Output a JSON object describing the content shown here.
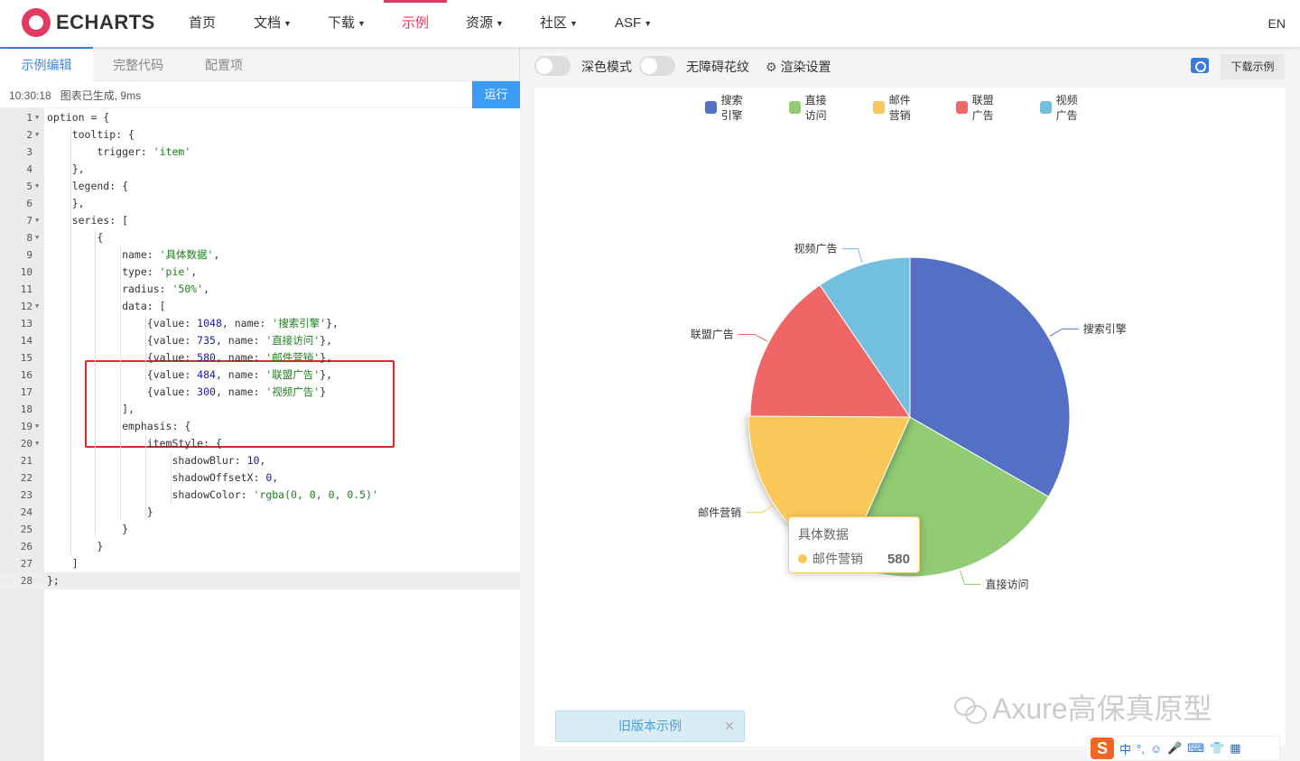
{
  "nav": {
    "logo": "ECHARTS",
    "items": [
      {
        "label": "首页",
        "dropdown": false
      },
      {
        "label": "文档",
        "dropdown": true
      },
      {
        "label": "下载",
        "dropdown": true
      },
      {
        "label": "示例",
        "dropdown": false,
        "active": true
      },
      {
        "label": "资源",
        "dropdown": true
      },
      {
        "label": "社区",
        "dropdown": true
      },
      {
        "label": "ASF",
        "dropdown": true
      }
    ],
    "lang": "EN"
  },
  "editor": {
    "tabs": [
      "示例编辑",
      "完整代码",
      "配置项"
    ],
    "status_time": "10:30:18",
    "status_msg": "图表已生成, 9ms",
    "run_label": "运行",
    "lines": [
      "option = {",
      "    tooltip: {",
      "        trigger: 'item'",
      "    },",
      "    legend: {",
      "    },",
      "    series: [",
      "        {",
      "            name: '具体数据',",
      "            type: 'pie',",
      "            radius: '50%',",
      "            data: [",
      "                {value: 1048, name: '搜索引擎'},",
      "                {value: 735, name: '直接访问'},",
      "                {value: 580, name: '邮件营销'},",
      "                {value: 484, name: '联盟广告'},",
      "                {value: 300, name: '视频广告'}",
      "            ],",
      "            emphasis: {",
      "                itemStyle: {",
      "                    shadowBlur: 10,",
      "                    shadowOffsetX: 0,",
      "                    shadowColor: 'rgba(0, 0, 0, 0.5)'",
      "                }",
      "            }",
      "        }",
      "    ]",
      "};"
    ]
  },
  "toolbar": {
    "dark_mode": "深色模式",
    "a11y": "无障碍花纹",
    "render_settings": "渲染设置",
    "download": "下载示例"
  },
  "old_version": "旧版本示例",
  "watermark": "Axure高保真原型",
  "ime": {
    "logo": "S",
    "items": [
      "中",
      "°,",
      "☺",
      "🎤",
      "⌨",
      "👕",
      "▦"
    ]
  },
  "chart_data": {
    "type": "pie",
    "series_name": "具体数据",
    "categories": [
      "搜索引擎",
      "直接访问",
      "邮件营销",
      "联盟广告",
      "视频广告"
    ],
    "values": [
      1048,
      735,
      580,
      484,
      300
    ],
    "colors": [
      "#5470c6",
      "#91cc75",
      "#fac858",
      "#ee6666",
      "#73c0de"
    ],
    "legend_position": "top-center",
    "highlighted": "邮件营销",
    "tooltip": {
      "title": "具体数据",
      "name": "邮件营销",
      "value": "580"
    }
  }
}
